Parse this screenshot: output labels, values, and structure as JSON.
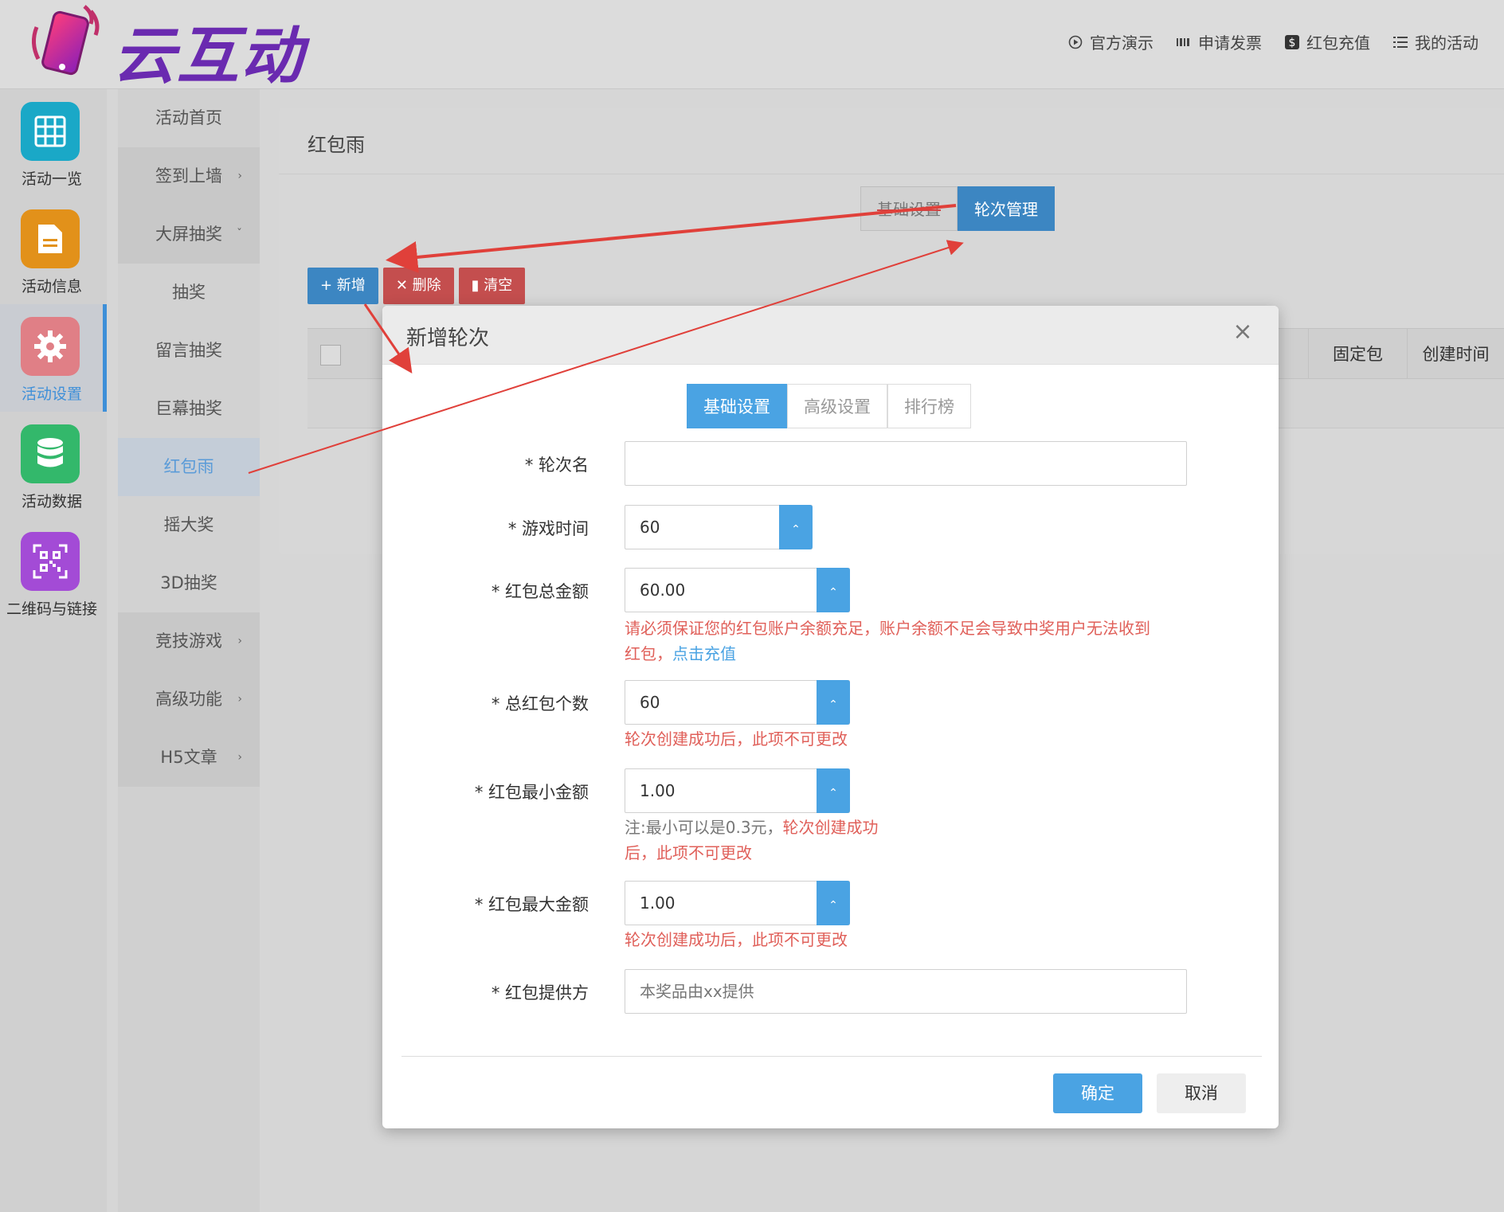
{
  "header": {
    "brand": "云互动",
    "nav": [
      {
        "icon": "play-circle-icon",
        "label": "官方演示"
      },
      {
        "icon": "barcode-icon",
        "label": "申请发票"
      },
      {
        "icon": "dollar-icon",
        "label": "红包充值"
      },
      {
        "icon": "list-icon",
        "label": "我的活动"
      }
    ]
  },
  "iconcol": [
    {
      "label": "活动一览",
      "icon": "grid-icon",
      "color": "#1aa8c7"
    },
    {
      "label": "活动信息",
      "icon": "document-icon",
      "color": "#e2911a"
    },
    {
      "label": "活动设置",
      "icon": "gear-icon",
      "color": "#e07f86",
      "active": true
    },
    {
      "label": "活动数据",
      "icon": "database-icon",
      "color": "#33b86b"
    },
    {
      "label": "二维码与链接",
      "icon": "qrcode-icon",
      "color": "#a34bd6"
    }
  ],
  "subnav": [
    {
      "label": "活动首页"
    },
    {
      "label": "签到上墙",
      "chevron": "›"
    },
    {
      "label": "大屏抽奖",
      "chevron": "ˇ"
    },
    {
      "label": "抽奖"
    },
    {
      "label": "留言抽奖"
    },
    {
      "label": "巨幕抽奖"
    },
    {
      "label": "红包雨"
    },
    {
      "label": "摇大奖"
    },
    {
      "label": "3D抽奖"
    },
    {
      "label": "竞技游戏",
      "chevron": "›"
    },
    {
      "label": "高级功能",
      "chevron": "›"
    },
    {
      "label": "H5文章",
      "chevron": "›"
    }
  ],
  "main": {
    "title": "红包雨",
    "tabs": [
      "基础设置",
      "轮次管理"
    ],
    "actions": {
      "add": "+ 新增",
      "delete": "✕ 删除",
      "clear": "清空"
    },
    "table_headers": [
      "固定包",
      "创建时间"
    ]
  },
  "modal": {
    "title": "新增轮次",
    "close": "×",
    "tabs": [
      "基础设置",
      "高级设置",
      "排行榜"
    ],
    "fields": {
      "round_name": {
        "label": "* 轮次名",
        "value": ""
      },
      "game_time": {
        "label": "* 游戏时间",
        "value": "60"
      },
      "total_amount": {
        "label": "* 红包总金额",
        "value": "60.00"
      },
      "total_count": {
        "label": "* 总红包个数",
        "value": "60"
      },
      "min_amount": {
        "label": "* 红包最小金额",
        "value": "1.00"
      },
      "max_amount": {
        "label": "* 红包最大金额",
        "value": "1.00"
      },
      "provider": {
        "label": "* 红包提供方",
        "placeholder": "本奖品由xx提供"
      }
    },
    "hints": {
      "amount_line1": "请必须保证您的红包账户余额充足，账户余额不足会导致中奖用户无法收到",
      "amount_line2": "红包，",
      "amount_link": "点击充值",
      "count": "轮次创建成功后，此项不可更改",
      "min_note": "注:最小可以是0.3元，",
      "min_red1": "轮次创建成功",
      "min_red2": "后，此项不可更改",
      "max": "轮次创建成功后，此项不可更改"
    },
    "ok": "确定",
    "cancel": "取消"
  }
}
